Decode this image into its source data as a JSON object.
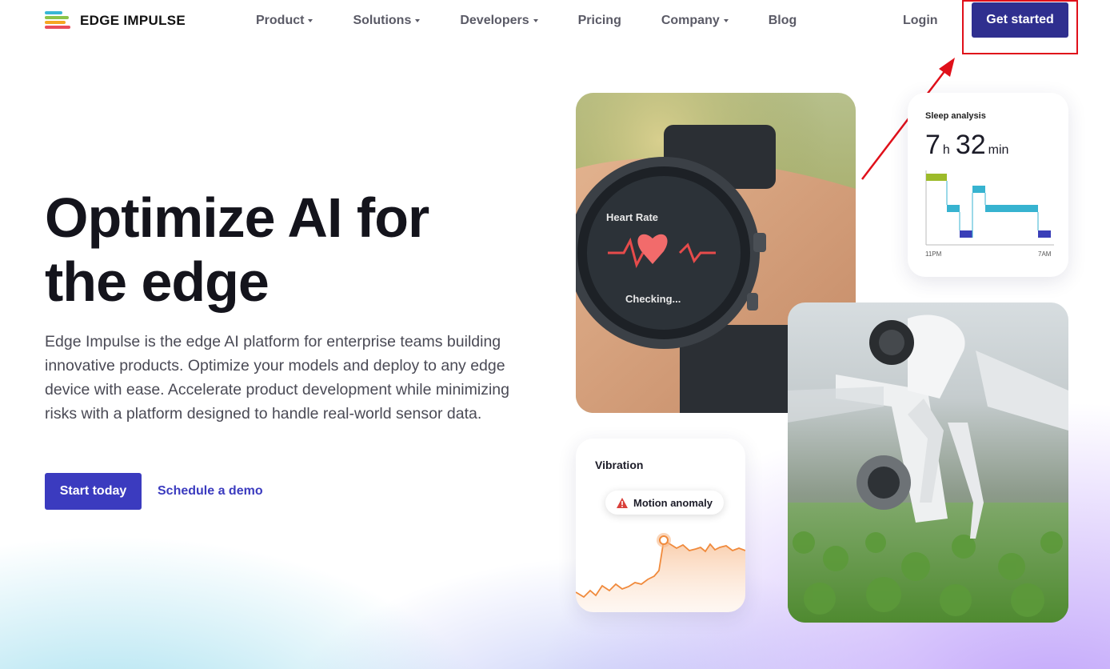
{
  "nav": {
    "brand": "EDGE IMPULSE",
    "menu": [
      {
        "label": "Product",
        "dropdown": true
      },
      {
        "label": "Solutions",
        "dropdown": true
      },
      {
        "label": "Developers",
        "dropdown": true
      },
      {
        "label": "Pricing",
        "dropdown": false
      },
      {
        "label": "Company",
        "dropdown": true
      },
      {
        "label": "Blog",
        "dropdown": false
      }
    ],
    "login": "Login",
    "cta": "Get started"
  },
  "hero": {
    "title_line1": "Optimize AI for",
    "title_line2": "the edge",
    "description": "Edge Impulse is the edge AI platform for enterprise teams building innovative products. Optimize your models and deploy to any edge device with ease. Accelerate product development while minimizing risks with a platform designed to handle real-world sensor data.",
    "primary_button": "Start today",
    "secondary_link": "Schedule a demo"
  },
  "watch_screen": {
    "label": "Heart Rate",
    "status": "Checking..."
  },
  "sleep_card": {
    "title": "Sleep analysis",
    "hours": "7",
    "hours_unit": "h",
    "minutes": "32",
    "minutes_unit": "min",
    "start_label": "11PM",
    "end_label": "7AM"
  },
  "vibration_card": {
    "title": "Vibration",
    "alert": "Motion anomaly"
  },
  "colors": {
    "brand_dark": "#2f2f8f",
    "brand": "#3b3bbf",
    "annotation_red": "#e0101a",
    "sleep_light": "#9dbb2a",
    "sleep_mid": "#37b3d0",
    "sleep_deep": "#3a3fb8",
    "vibration_line": "#f08a3c"
  }
}
